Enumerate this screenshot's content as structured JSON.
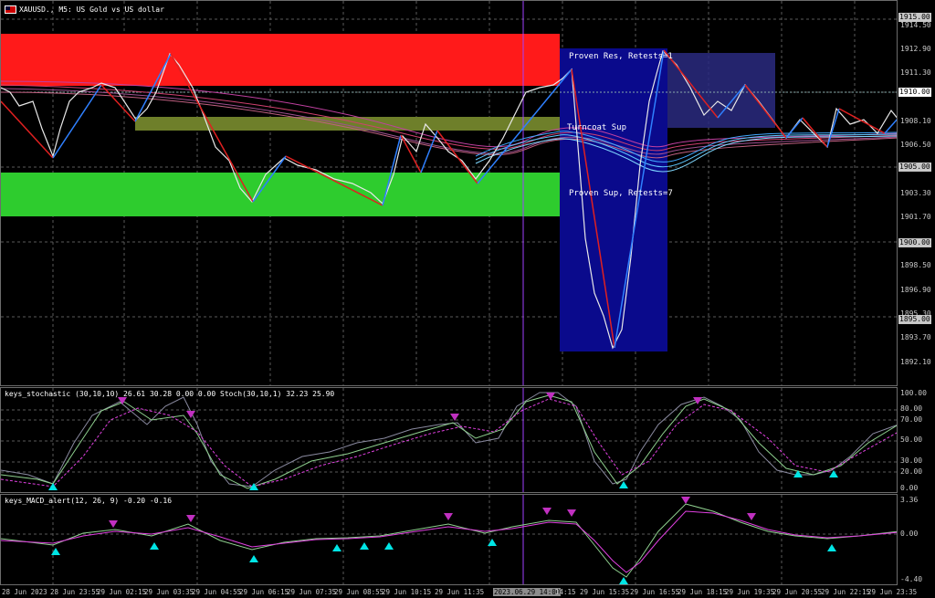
{
  "chart_header": {
    "symbol_title": "XAUUSD., M5:  US Gold vs US dollar"
  },
  "price_axis": {
    "labels": [
      "1915.00",
      "1914.50",
      "1912.90",
      "1911.30",
      "1910.00",
      "1908.10",
      "1906.50",
      "1905.00",
      "1903.30",
      "1901.70",
      "1900.00",
      "1898.50",
      "1896.90",
      "1895.30",
      "1895.00",
      "1893.70",
      "1892.10"
    ],
    "current_price": "1910.00"
  },
  "zones": {
    "proven_res": "Proven Res, Retests=1",
    "turncoat_sup": "Turncoat Sup",
    "proven_sup": "Proven Sup, Retests=7"
  },
  "stochastic": {
    "title": "keys_stochastic (30,10,10) 26.61 30.28 0.00 0.00 Stoch(30,10,1) 32.23 25.90",
    "levels": [
      "100.00",
      "80.00",
      "70.00",
      "50.00",
      "30.00",
      "20.00",
      "0.00"
    ]
  },
  "macd": {
    "title": "keys_MACD_alert(12, 26, 9) -0.20 -0.16",
    "levels": [
      "3.36",
      "0.00",
      "-4.40"
    ]
  },
  "time_axis": {
    "labels": [
      "28 Jun 2023",
      "28 Jun 23:55",
      "29 Jun 02:15",
      "29 Jun 03:35",
      "29 Jun 04:55",
      "29 Jun 06:15",
      "29 Jun 07:35",
      "29 Jun 08:55",
      "29 Jun 10:15",
      "29 Jun 11:35",
      "2023.06.29 14:00",
      "14:15",
      "29 Jun 15:35",
      "29 Jun 16:55",
      "29 Jun 18:15",
      "29 Jun 19:35",
      "29 Jun 20:55",
      "29 Jun 22:15",
      "29 Jun 23:35"
    ],
    "highlighted": "2023.06.29 14:00"
  },
  "colors": {
    "resistance_zone": "#ff1a1a",
    "support_zone": "#2ecc2e",
    "turncoat_zone": "#6e7f2a",
    "proven_box": "#0a0a8c",
    "stoch_main": "#8fd18f",
    "stoch_signal": "#e040e0",
    "macd_line": "#8fd18f",
    "macd_signal": "#e040e0",
    "arrow_up": "#00e5e5",
    "arrow_down": "#c030c0"
  }
}
